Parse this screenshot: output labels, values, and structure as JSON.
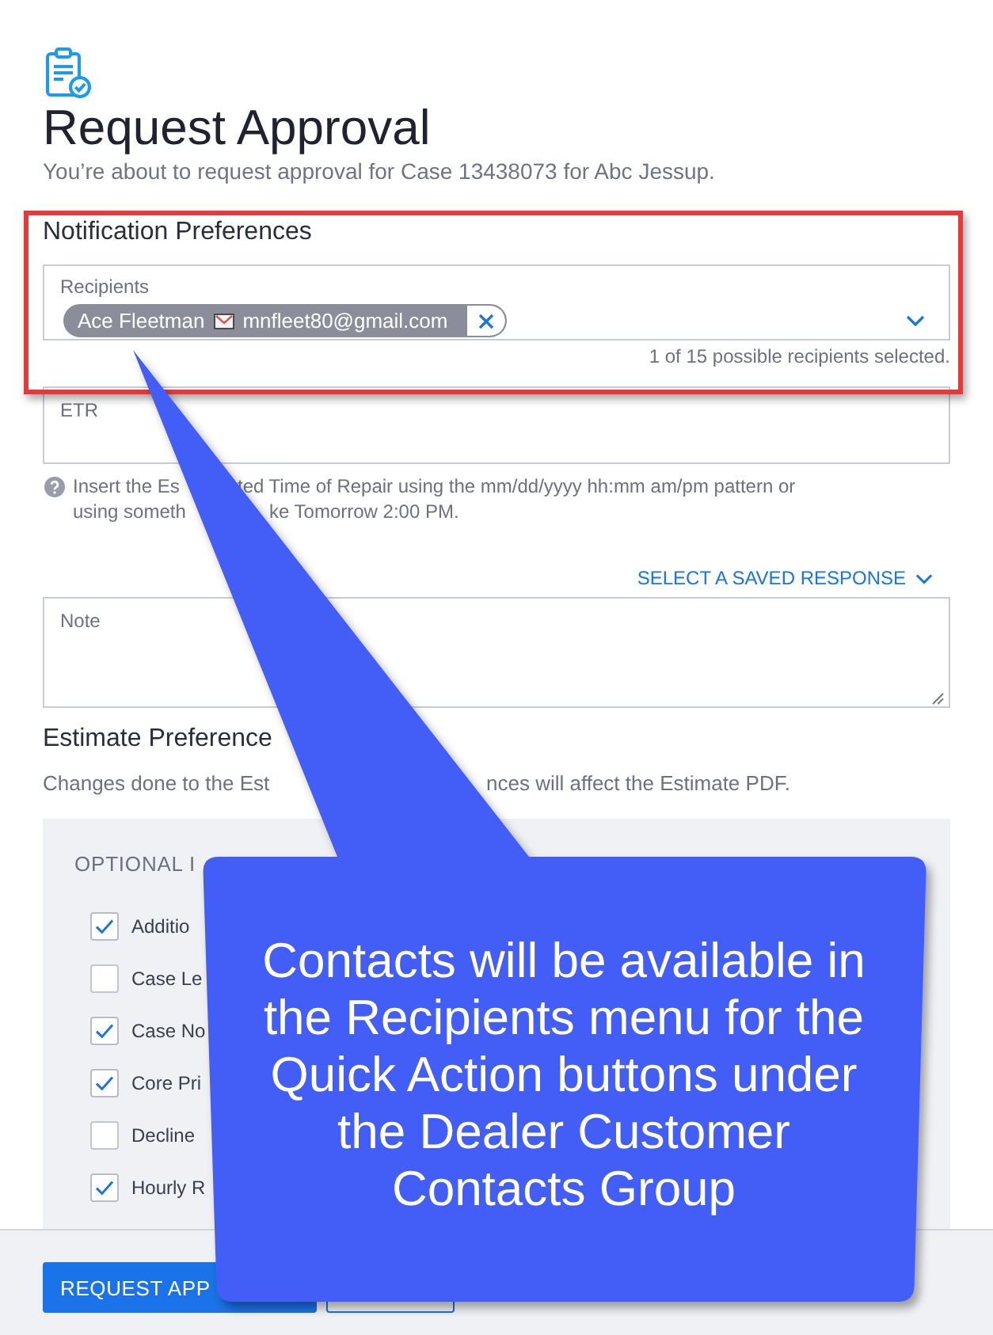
{
  "header": {
    "title": "Request Approval",
    "subtitle": "You’re about to request approval for Case 13438073 for Abc Jessup."
  },
  "notification_preferences": {
    "heading": "Notification Preferences",
    "recipients": {
      "label": "Recipients",
      "chips": [
        {
          "name": "Ace Fleetman",
          "email": "mnfleet80@gmail.com"
        }
      ],
      "summary": "1 of 15 possible recipients selected."
    }
  },
  "etr": {
    "label": "ETR",
    "help_lines": [
      [
        "Insert the Es",
        "ted Time of Repair using the mm/dd/yyyy hh:mm am/pm pattern or"
      ],
      [
        "using someth",
        "ke Tomorrow 2:00 PM."
      ]
    ]
  },
  "saved_response_link": "SELECT A SAVED RESPONSE",
  "note": {
    "label": "Note"
  },
  "estimate_preferences": {
    "heading": "Estimate Preference",
    "description": [
      "Changes done to the Est",
      "nces will affect the Estimate PDF."
    ],
    "optional_items": {
      "heading": "OPTIONAL I",
      "items": [
        {
          "label": "Additio",
          "checked": true
        },
        {
          "label": "Case Le",
          "checked": false
        },
        {
          "label": "Case No",
          "checked": true
        },
        {
          "label": "Core Pri",
          "checked": true
        },
        {
          "label": "Decline",
          "checked": false
        },
        {
          "label": "Hourly R",
          "checked": true
        }
      ]
    }
  },
  "footer": {
    "buttons": [
      {
        "kind": "primary",
        "label": "REQUEST APP"
      },
      {
        "kind": "secondary"
      }
    ]
  },
  "callout": {
    "text": "Contacts will be available in the Recipients menu for the Quick Action buttons under the Dealer Customer Contacts Group"
  }
}
